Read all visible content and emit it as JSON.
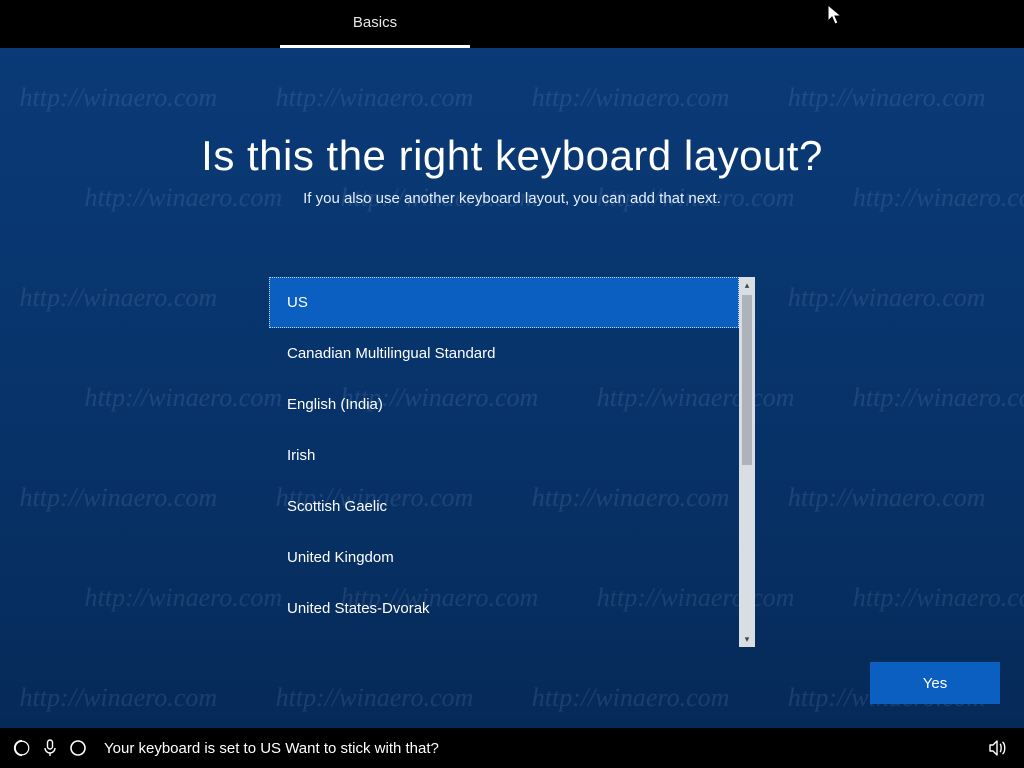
{
  "tabbar": {
    "active_tab": "Basics"
  },
  "title": "Is this the right keyboard layout?",
  "subtitle": "If you also use another keyboard layout, you can add that next.",
  "layouts": [
    "US",
    "Canadian Multilingual Standard",
    "English (India)",
    "Irish",
    "Scottish Gaelic",
    "United Kingdom",
    "United States-Dvorak"
  ],
  "selected_index": 0,
  "yes_label": "Yes",
  "taskbar": {
    "cortana_text": "Your keyboard is set to US Want to stick with that?"
  },
  "watermark": "http://winaero.com"
}
